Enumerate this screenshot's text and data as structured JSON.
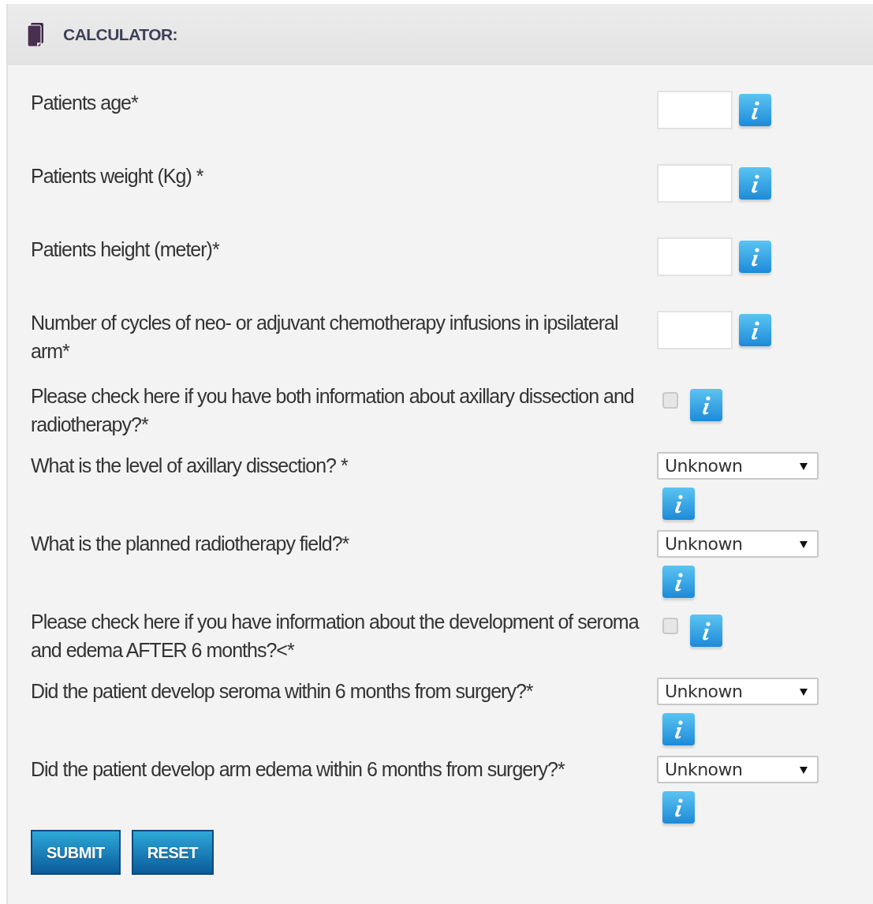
{
  "header": {
    "title": "CALCULATOR:"
  },
  "fields": [
    {
      "kind": "input",
      "label": "Patients age*"
    },
    {
      "kind": "input",
      "label": "Patients weight (Kg) *"
    },
    {
      "kind": "input",
      "label": "Patients height (meter)*"
    },
    {
      "kind": "input",
      "label": "Number of cycles of neo- or adjuvant chemotherapy infusions in ipsilateral arm*"
    },
    {
      "kind": "checkbox",
      "label": "Please check here if you have both information about axillary dissection and radiotherapy?*",
      "checked": false
    },
    {
      "kind": "select",
      "label": "What is the level of axillary dissection? *",
      "value": "Unknown"
    },
    {
      "kind": "select",
      "label": "What is the planned radiotherapy field?*",
      "value": "Unknown"
    },
    {
      "kind": "checkbox",
      "label": "Please check here if you have information about the development of seroma and edema AFTER 6 months?<*",
      "checked": false
    },
    {
      "kind": "select",
      "label": "Did the patient develop seroma within 6 months from surgery?*",
      "value": "Unknown"
    },
    {
      "kind": "select",
      "label": "Did the patient develop arm edema within 6 months from surgery?*",
      "value": "Unknown"
    }
  ],
  "buttons": [
    "SUBMIT",
    "RESET"
  ]
}
